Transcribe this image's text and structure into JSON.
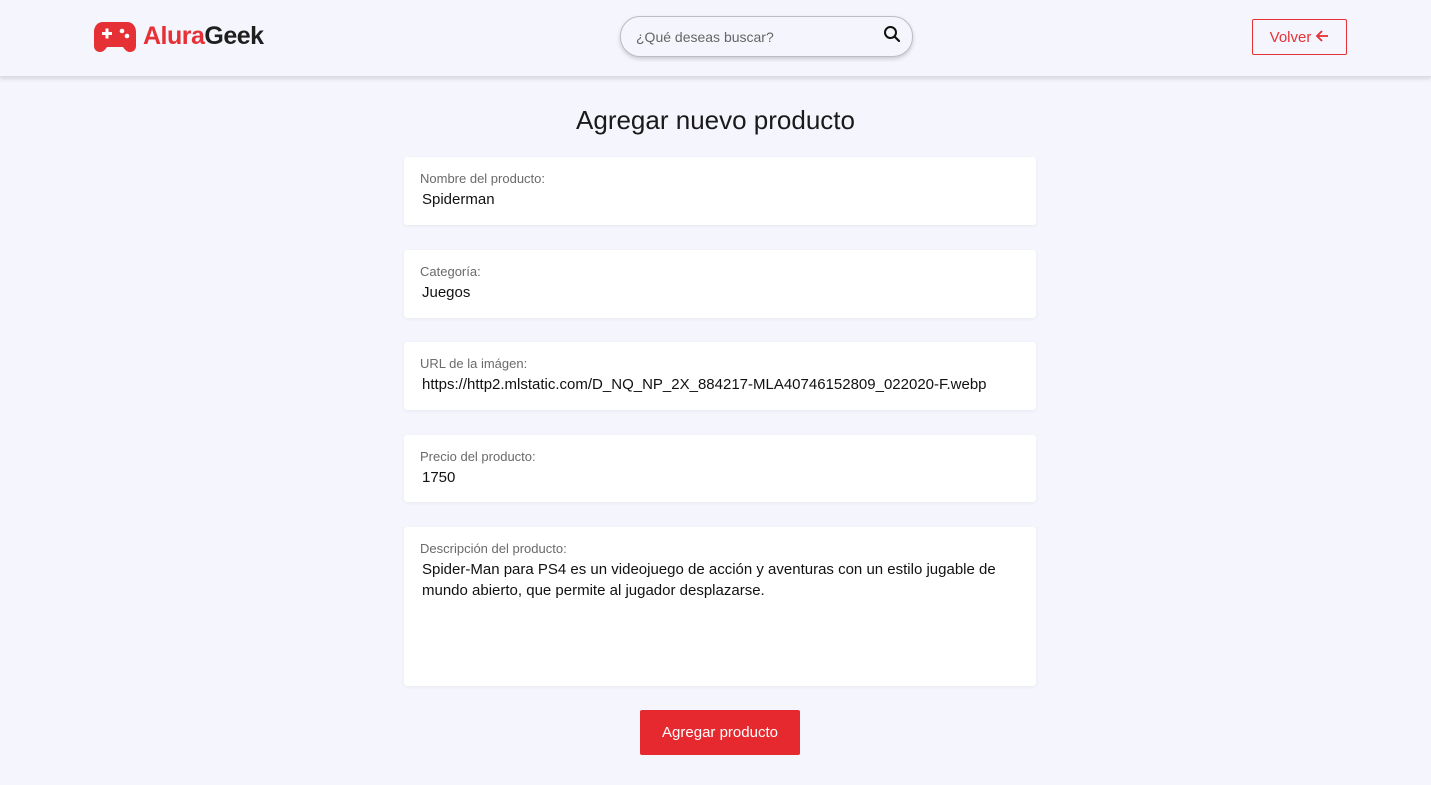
{
  "header": {
    "logo": {
      "brand_part1": "Alura",
      "brand_part2": "Geek",
      "icon": "gamepad-icon"
    },
    "search": {
      "placeholder": "¿Qué deseas buscar?",
      "value": "",
      "icon": "search-icon"
    },
    "back_button": {
      "label": "Volver",
      "icon": "arrow-left-icon"
    }
  },
  "page": {
    "title": "Agregar nuevo producto"
  },
  "form": {
    "name": {
      "label": "Nombre del producto:",
      "value": "Spiderman"
    },
    "category": {
      "label": "Categoría:",
      "value": "Juegos"
    },
    "image_url": {
      "label": "URL de la imágen:",
      "value": "https://http2.mlstatic.com/D_NQ_NP_2X_884217-MLA40746152809_022020-F.webp"
    },
    "price": {
      "label": "Precio del producto:",
      "value": "1750"
    },
    "description": {
      "label": "Descripción del producto:",
      "value": "Spider-Man para PS4 es un videojuego de acción y aventuras con un estilo jugable de mundo abierto, que permite al jugador desplazarse."
    },
    "submit_label": "Agregar producto"
  },
  "colors": {
    "accent": "#e53135",
    "background": "#f5f5fd",
    "field_background": "#ffffff",
    "label_text": "#6a6a6a"
  }
}
